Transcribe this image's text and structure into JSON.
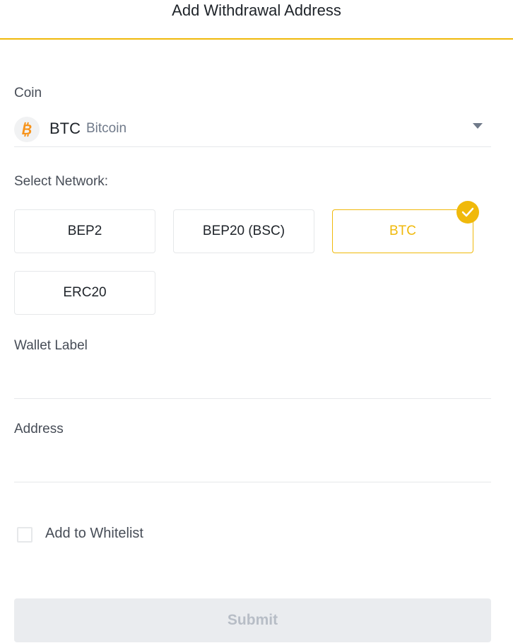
{
  "header": {
    "title": "Add Withdrawal Address"
  },
  "coin": {
    "label": "Coin",
    "symbol": "BTC",
    "name": "Bitcoin",
    "icon": "bitcoin-icon",
    "icon_color": "#f7931a"
  },
  "network": {
    "label": "Select Network:",
    "options": [
      {
        "label": "BEP2",
        "selected": false
      },
      {
        "label": "BEP20 (BSC)",
        "selected": false
      },
      {
        "label": "BTC",
        "selected": true
      },
      {
        "label": "ERC20",
        "selected": false
      }
    ]
  },
  "wallet_label": {
    "label": "Wallet Label",
    "value": ""
  },
  "address": {
    "label": "Address",
    "value": ""
  },
  "whitelist": {
    "label": "Add to Whitelist",
    "checked": false
  },
  "submit": {
    "label": "Submit",
    "enabled": false
  },
  "colors": {
    "accent": "#f0b90b",
    "disabled_bg": "#eaecef",
    "disabled_text": "#b7bdc6"
  }
}
